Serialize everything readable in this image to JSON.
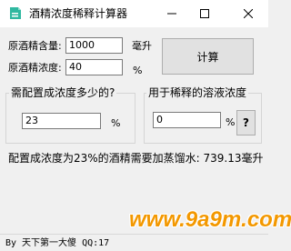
{
  "window": {
    "title": "酒精浓度稀释计算器",
    "icon": "app-logo-icon",
    "controls": {
      "minimize": "—",
      "maximize": "☐",
      "close": "✕"
    }
  },
  "inputs": {
    "original_volume_label": "原酒精含量:",
    "original_volume_value": "1000",
    "original_volume_unit": "毫升",
    "original_conc_label": "原酒精浓度:",
    "original_conc_value": "40",
    "original_conc_unit": "%",
    "calculate_label": "计算"
  },
  "target_group": {
    "title": "需配置成浓度多少的?",
    "value": "23",
    "unit": "%"
  },
  "diluent_group": {
    "title": "用于稀释的溶液浓度",
    "value": "0",
    "unit": "%",
    "help_label": "?"
  },
  "result_text": "配置成浓度为23%的酒精需要加蒸馏水: 739.13毫升",
  "status_text": "By 天下第一大傻 QQ:17",
  "watermark": "www.9a9m.com",
  "colors": {
    "accent_icon": "#2fb8a0",
    "watermark": "#f39800"
  }
}
